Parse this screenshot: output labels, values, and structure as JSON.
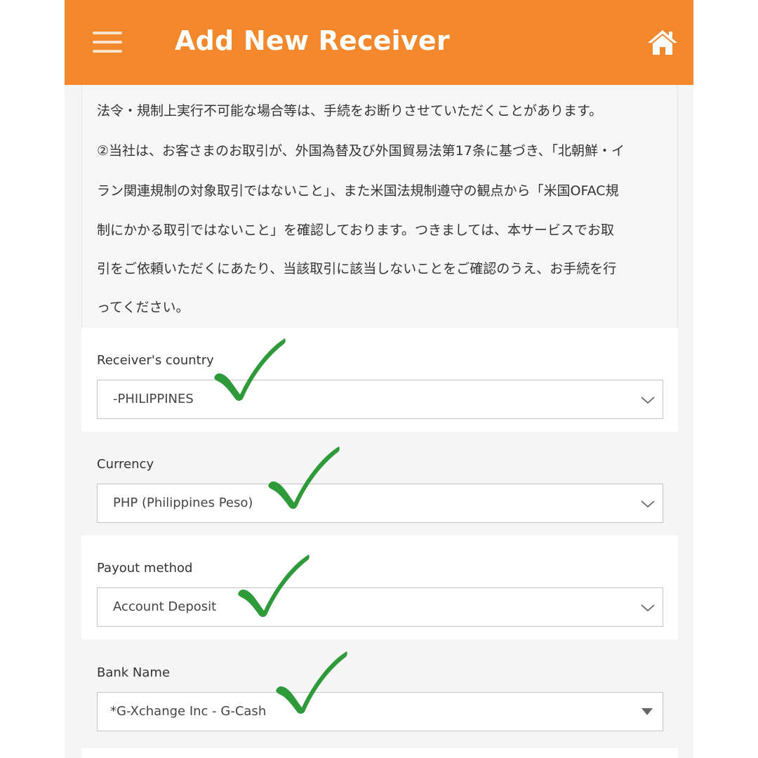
{
  "header": {
    "title": "Add New Receiver",
    "color": "#f2872c",
    "menu_icon": "hamburger-menu-icon",
    "home_icon": "home-icon"
  },
  "notice": {
    "lines": [
      "法令・規制上実行不可能な場合等は、手続をお断りさせていただくことがあります。",
      "②当社は、お客さまのお取引が、外国為替及び外国貿易法第17条に基づき、「北朝鮮・イ",
      "ラン関連規制の対象取引ではないこと」、また米国法規制遵守の観点から「米国OFAC規",
      "制にかかる取引ではないこと」を確認しております。つきましては、本サービスでお取",
      "引をご依頼いただくにあたり、当該取引に該当しないことをご確認のうえ、お手続を行",
      "ってください。"
    ]
  },
  "form": {
    "country": {
      "label": "Receiver's country",
      "value": "-PHILIPPINES"
    },
    "currency": {
      "label": "Currency",
      "value": "PHP (Philippines Peso)"
    },
    "payout": {
      "label": "Payout method",
      "value": "Account Deposit"
    },
    "bank": {
      "label": "Bank Name",
      "value": "*G-Xchange Inc - G-Cash"
    }
  },
  "annotation": {
    "check_color": "#2f9a3a",
    "check_icon": "checkmark-icon"
  }
}
